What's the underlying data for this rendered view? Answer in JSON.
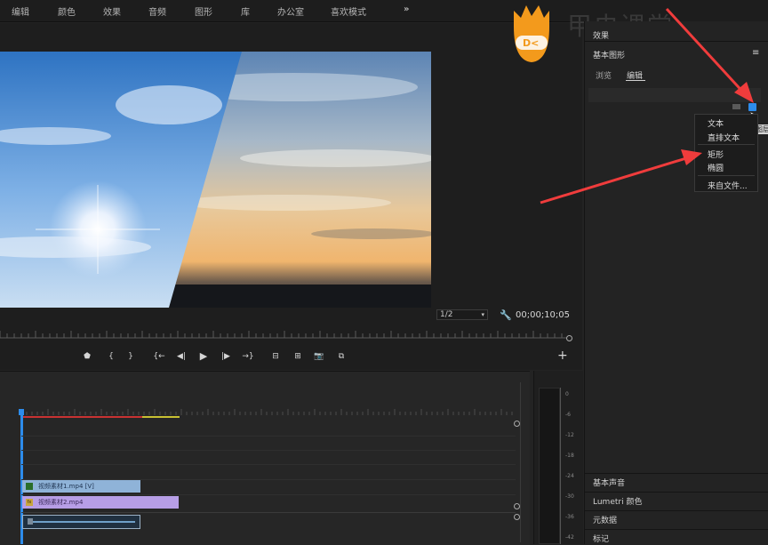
{
  "menu": [
    "编辑",
    "颜色",
    "效果",
    "音频",
    "图形",
    "库",
    "办公室",
    "喜欢模式"
  ],
  "menu_overflow": "»",
  "watermark": {
    "brand_text": "甲虫课堂",
    "logo_symbol": "D<"
  },
  "monitor": {
    "zoom": "1/2",
    "timecode": "00;00;10;05",
    "wrench_icon": "wrench-icon",
    "add_button": "+"
  },
  "transport": [
    "⬟",
    "{",
    "}",
    "{←",
    "◀|",
    "▶",
    "|▶",
    "→}",
    "⊟",
    "⊞",
    "📷",
    "⧉"
  ],
  "timeline": {
    "clips": [
      {
        "label": "视频素材1.mp4 [V]",
        "color": "#8fb3d8",
        "badge_color": "#2a6e2a"
      },
      {
        "label": "视频素材2.mp4",
        "color": "#b79ee6",
        "badge_color": "#c9a640",
        "badge": "fx"
      }
    ]
  },
  "meter_labels": [
    "0",
    "-6",
    "-12",
    "-18",
    "-24",
    "-30",
    "-36",
    "-42"
  ],
  "right_panel": {
    "effects_title": "效果",
    "essential_graphics_title": "基本图形",
    "tabs": [
      "浏览",
      "编辑"
    ],
    "active_tab": "编辑",
    "new_layer_tooltip": "新建图层",
    "context_menu": [
      "文本",
      "直排文本",
      "矩形",
      "椭圆",
      "来自文件..."
    ],
    "bottom_panels": [
      "基本声音",
      "Lumetri 颜色",
      "元数据",
      "标记"
    ]
  },
  "colors": {
    "accent": "#2d8ceb",
    "arrow": "#f03c3c",
    "logo": "#f39a1c"
  }
}
